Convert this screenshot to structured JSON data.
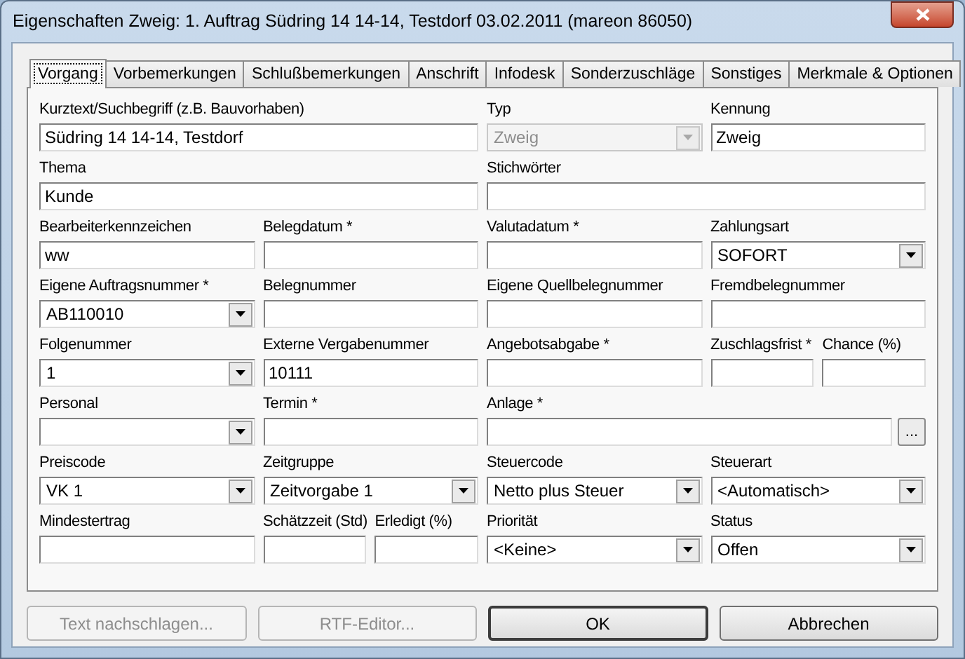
{
  "window": {
    "title": "Eigenschaften Zweig: 1. Auftrag Südring 14 14-14, Testdorf 03.02.2011 (mareon 86050)"
  },
  "tabs": [
    {
      "label": "Vorgang",
      "selected": true
    },
    {
      "label": "Vorbemerkungen",
      "selected": false
    },
    {
      "label": "Schlußbemerkungen",
      "selected": false
    },
    {
      "label": "Anschrift",
      "selected": false
    },
    {
      "label": "Infodesk",
      "selected": false
    },
    {
      "label": "Sonderzuschläge",
      "selected": false
    },
    {
      "label": "Sonstiges",
      "selected": false
    },
    {
      "label": "Merkmale & Optionen",
      "selected": false
    }
  ],
  "rows": [
    {
      "fields": [
        {
          "label": "Kurztext/Suchbegriff (z.B. Bauvorhaben)",
          "kind": "text",
          "value": "Südring 14 14-14, Testdorf"
        },
        {
          "label": "Typ",
          "kind": "combo",
          "value": "Zweig",
          "disabled": true
        },
        {
          "label": "Kennung",
          "kind": "text",
          "value": "Zweig"
        }
      ]
    },
    {
      "fields": [
        {
          "label": "Thema",
          "kind": "text",
          "value": "Kunde"
        },
        {
          "label": "Stichwörter",
          "kind": "text"
        }
      ]
    },
    {
      "fields": [
        {
          "label": "Bearbeiterkennzeichen",
          "kind": "text",
          "value": "ww"
        },
        {
          "label": "Belegdatum *",
          "kind": "text"
        },
        {
          "label": "Valutadatum *",
          "kind": "text"
        },
        {
          "label": "Zahlungsart",
          "kind": "combo",
          "value": "SOFORT",
          "disabled": false
        }
      ]
    },
    {
      "fields": [
        {
          "label": "Eigene Auftragsnummer *",
          "kind": "combo",
          "value": "AB110010",
          "disabled": false
        },
        {
          "label": "Belegnummer",
          "kind": "text"
        },
        {
          "label": "Eigene Quellbelegnummer",
          "kind": "text"
        },
        {
          "label": "Fremdbelegnummer",
          "kind": "text"
        }
      ]
    },
    {
      "fields": [
        {
          "label": "Folgenummer",
          "kind": "combo",
          "value": "1",
          "disabled": false
        },
        {
          "label": "Externe Vergabenummer",
          "kind": "text",
          "value": "10111"
        },
        {
          "label": "Angebotsabgabe *",
          "kind": "text"
        },
        {
          "label": "Zuschlagsfrist *",
          "kind": "text"
        },
        {
          "label": "Chance (%)",
          "kind": "text"
        }
      ]
    },
    {
      "fields": [
        {
          "label": "Personal",
          "kind": "combo",
          "disabled": false
        },
        {
          "label": "Termin *",
          "kind": "text"
        },
        {
          "label": "Anlage *",
          "kind": "picker",
          "button": "..."
        }
      ]
    },
    {
      "fields": [
        {
          "label": "Preiscode",
          "kind": "combo",
          "value": "VK 1",
          "disabled": false
        },
        {
          "label": "Zeitgruppe",
          "kind": "combo",
          "value": "Zeitvorgabe 1",
          "disabled": false
        },
        {
          "label": "Steuercode",
          "kind": "combo",
          "value": "Netto plus Steuer",
          "disabled": false
        },
        {
          "label": "Steuerart",
          "kind": "combo",
          "value": "<Automatisch>",
          "disabled": false
        }
      ]
    },
    {
      "fields": [
        {
          "label": "Mindestertrag",
          "kind": "text"
        },
        {
          "label": "Schätzzeit (Std)",
          "kind": "text"
        },
        {
          "label": "Erledigt (%)",
          "kind": "text"
        },
        {
          "label": "Priorität",
          "kind": "combo",
          "value": "<Keine>",
          "disabled": false
        },
        {
          "label": "Status",
          "kind": "combo",
          "value": "Offen",
          "disabled": false
        }
      ]
    }
  ],
  "buttons": [
    {
      "label": "Text nachschlagen...",
      "disabled": true,
      "default": false
    },
    {
      "label": "RTF-Editor...",
      "disabled": true,
      "default": false
    },
    {
      "label": "OK",
      "disabled": false,
      "default": true
    },
    {
      "label": "Abbrechen",
      "disabled": false,
      "default": false
    }
  ]
}
